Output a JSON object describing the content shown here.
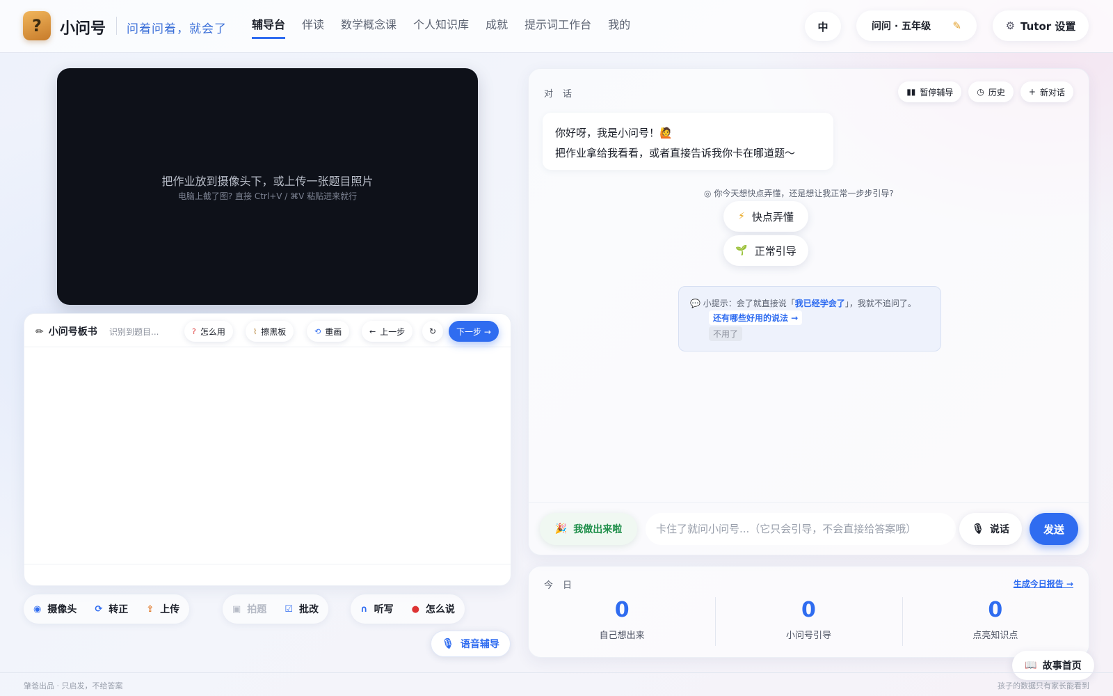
{
  "app": {
    "name": "小问号",
    "slogan": "问着问着，就会了",
    "logo_glyph": "?"
  },
  "nav": {
    "items": [
      "辅导台",
      "伴读",
      "数学概念课",
      "个人知识库",
      "成就",
      "提示词工作台",
      "我的"
    ],
    "active": "辅导台"
  },
  "header": {
    "lang": "中",
    "user": "问问 · 五年级",
    "tutor_settings": "Tutor 设置"
  },
  "camera": {
    "main_text": "把作业放到摄像头下，或上传一张题目照片",
    "sub_text": "电脑上截了图? 直接 Ctrl+V / ⌘V 粘贴进来就行"
  },
  "board": {
    "title": "小问号板书",
    "status": "识别到题目...",
    "buttons": {
      "how": "怎么用",
      "erase": "擦黑板",
      "redraw": "重画",
      "prev": "上一步",
      "refresh": "↻",
      "next": "下一步 →"
    }
  },
  "tools": {
    "camera": "摄像头",
    "rotate": "转正",
    "upload": "上传",
    "snap": "拍题",
    "grade": "批改",
    "dictation": "听写",
    "howto_say": "怎么说",
    "voice": "语音辅导"
  },
  "chat": {
    "label": "对话",
    "actions": {
      "pause": "暂停辅导",
      "history": "历史",
      "new": "新对话"
    },
    "greeting_line1": "你好呀，我是小问号！🙋",
    "greeting_line2": "把作业拿给我看看，或者直接告诉我你卡在哪道题～",
    "question": "你今天想快点弄懂，还是想让我正常一步步引导?",
    "choices": {
      "fast": "快点弄懂",
      "normal": "正常引导"
    },
    "tip": {
      "prefix": "小提示：会了就直接说「",
      "highlight": "我已经学会了",
      "suffix": "」，我就不追问了。",
      "link": "还有哪些好用的说法 →",
      "dismiss": "不用了"
    },
    "done_button": "我做出来啦",
    "input_placeholder": "卡住了就问小问号...（它只会引导，不会直接给答案哦）",
    "talk_button": "说话",
    "send_button": "发送"
  },
  "today": {
    "label": "今日",
    "report_link": "生成今日报告 →",
    "stats": [
      {
        "value": "0",
        "label": "自己想出来"
      },
      {
        "value": "0",
        "label": "小问号引导"
      },
      {
        "value": "0",
        "label": "点亮知识点"
      }
    ]
  },
  "story_button": "故事首页",
  "footer": {
    "left": "肇爸出品 · 只启发，不给答案",
    "right": "孩子的数据只有家长能看到"
  },
  "colors": {
    "accent": "#2f6cf0",
    "success": "#1f8f4a",
    "camera_bg": "#0e1119"
  },
  "icons": {
    "pen": "pencil-icon",
    "question": "question-icon",
    "broom": "broom-icon",
    "redraw": "redraw-icon",
    "camera": "camera-icon",
    "gear": "gear-icon",
    "mic": "mic-icon",
    "book": "book-icon"
  }
}
